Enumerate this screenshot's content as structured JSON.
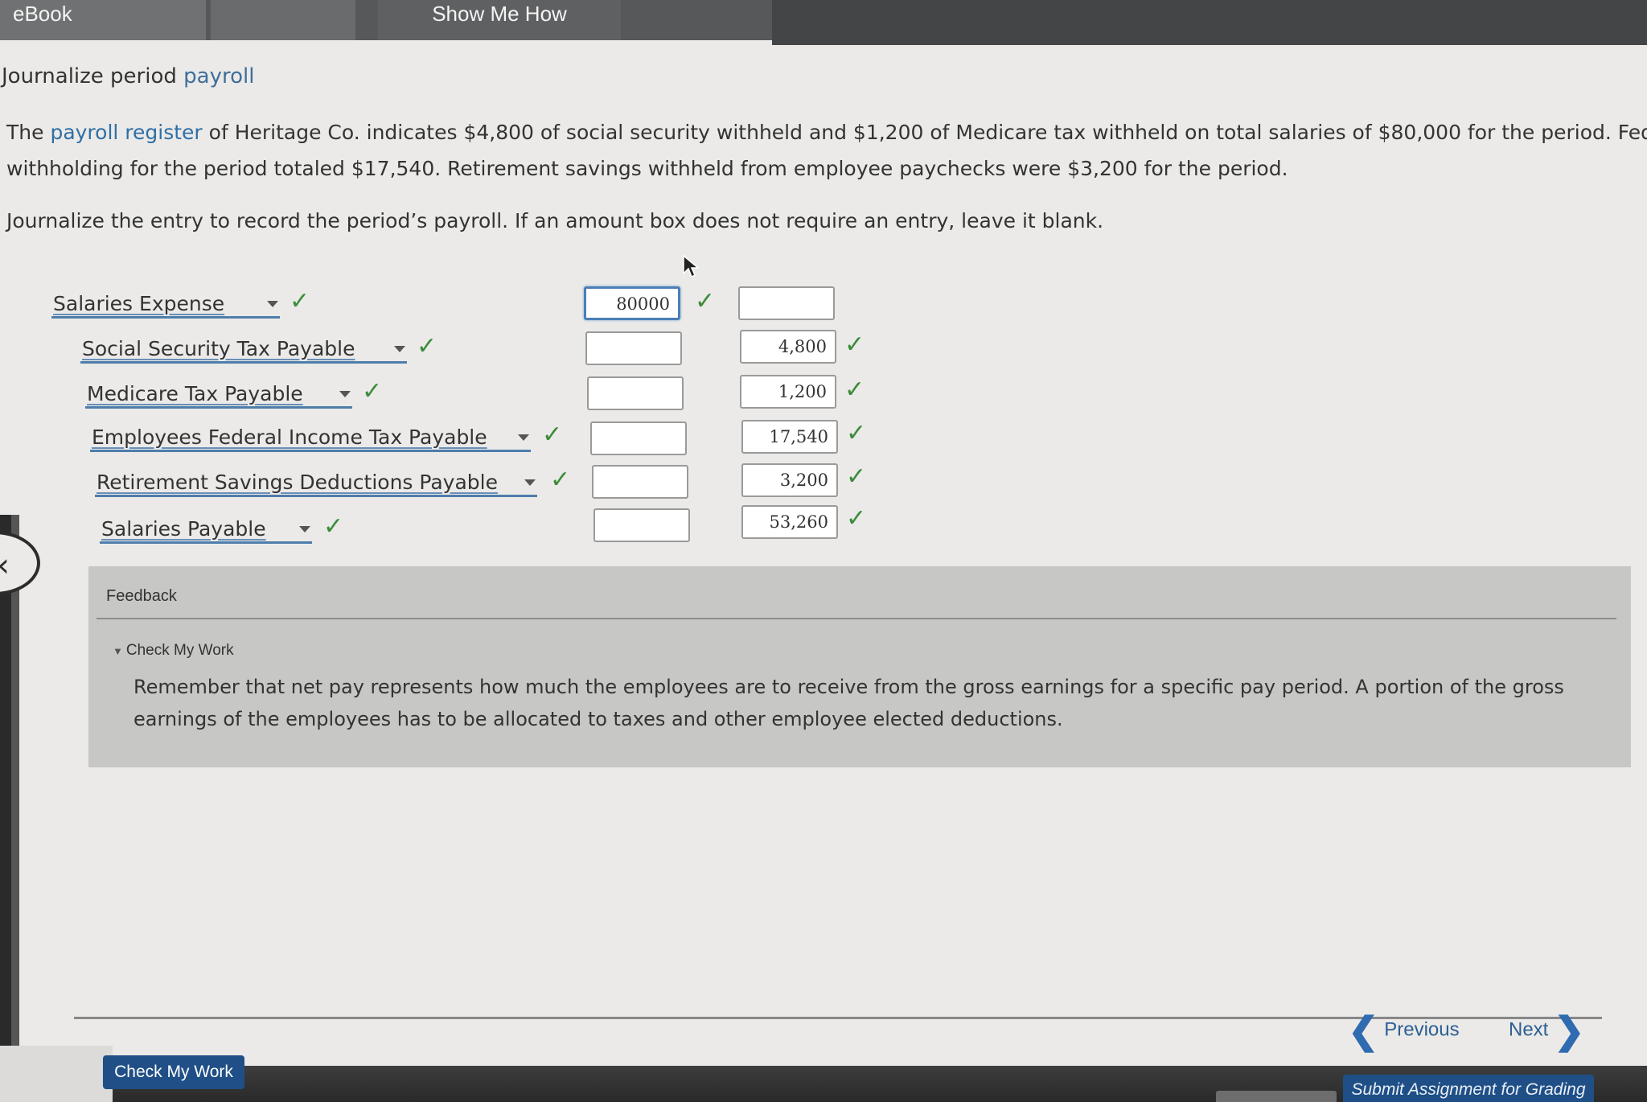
{
  "tabs": [
    "eBook",
    "Show Me How"
  ],
  "title": {
    "prefix": "Journalize period",
    "link": "payroll"
  },
  "problem": {
    "part1": "The ",
    "link": "payroll register",
    "part2": " of Heritage Co. indicates $4,800 of social security withheld and $1,200 of Medicare tax withheld on total salaries of $80,000 for the period. Federa",
    "line2": "withholding for the period totaled $17,540. Retirement savings withheld from employee paychecks were $3,200 for the period."
  },
  "instructions": "Journalize the entry to record the period’s payroll. If an amount box does not require an entry, leave it blank.",
  "journal": {
    "rows": [
      {
        "account": "Salaries Expense",
        "debit": "80000",
        "credit": ""
      },
      {
        "account": "Social Security Tax Payable",
        "debit": "",
        "credit": "4,800"
      },
      {
        "account": "Medicare Tax Payable",
        "debit": "",
        "credit": "1,200"
      },
      {
        "account": "Employees Federal Income Tax Payable",
        "debit": "",
        "credit": "17,540"
      },
      {
        "account": "Retirement Savings Deductions Payable",
        "debit": "",
        "credit": "3,200"
      },
      {
        "account": "Salaries Payable",
        "debit": "",
        "credit": "53,260"
      }
    ]
  },
  "feedback": {
    "title": "Feedback",
    "toggle_label": "Check My Work",
    "text": "Remember that net pay represents how much the employees are to receive from the gross earnings for a specific pay period. A portion of the gross earnings of the employees has to be allocated to taxes and other employee elected deductions."
  },
  "nav": {
    "previous": "Previous",
    "next": "Next"
  },
  "buttons": {
    "check_my_work": "Check My Work",
    "submit": "Submit Assignment for Grading"
  },
  "colors": {
    "accent": "#1f4f86",
    "link": "#2f6fa6",
    "check": "#3b8c3b"
  }
}
